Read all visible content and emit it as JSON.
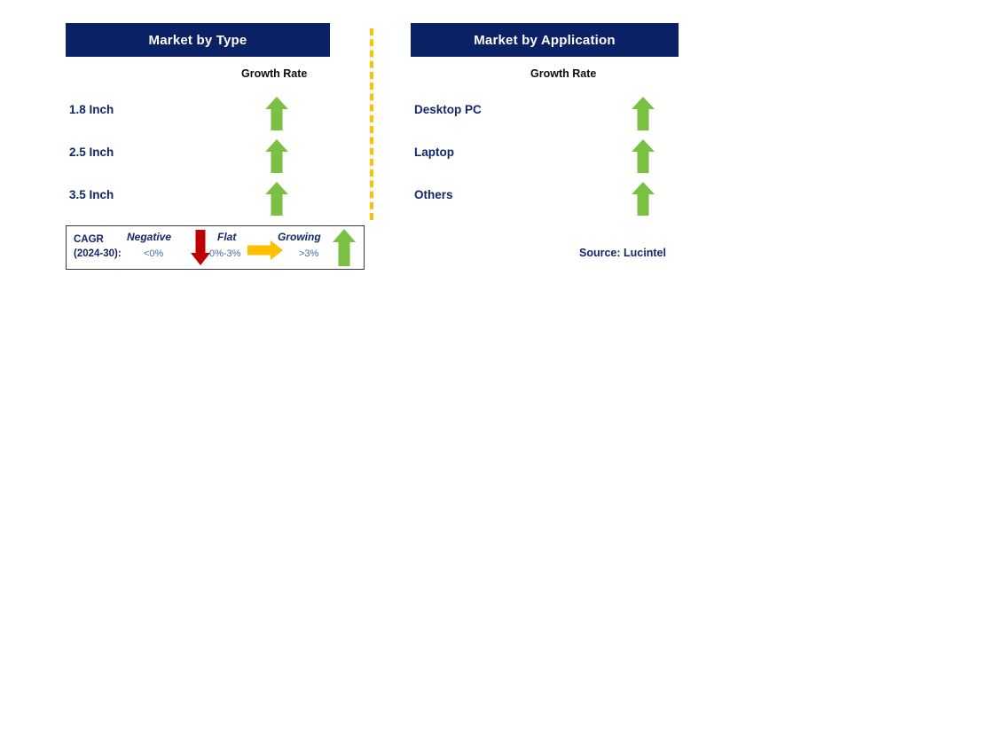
{
  "divider": {
    "color": "#FFC000",
    "style": "dashed-vertical"
  },
  "panels": [
    {
      "id": "type",
      "title": "Market by Type",
      "column_header": "Growth Rate",
      "rows": [
        {
          "label": "1.8 Inch",
          "growth": "growing",
          "icon": "up-arrow-icon"
        },
        {
          "label": "2.5 Inch",
          "growth": "growing",
          "icon": "up-arrow-icon"
        },
        {
          "label": "3.5 Inch",
          "growth": "growing",
          "icon": "up-arrow-icon"
        }
      ]
    },
    {
      "id": "application",
      "title": "Market by Application",
      "column_header": "Growth Rate",
      "rows": [
        {
          "label": "Desktop PC",
          "growth": "growing",
          "icon": "up-arrow-icon"
        },
        {
          "label": "Laptop",
          "growth": "growing",
          "icon": "up-arrow-icon"
        },
        {
          "label": "Others",
          "growth": "growing",
          "icon": "up-arrow-icon"
        }
      ]
    }
  ],
  "legend": {
    "cagr_line1": "CAGR",
    "cagr_line2": "(2024-30):",
    "items": [
      {
        "title": "Negative",
        "value": "<0%",
        "icon": "down-arrow-icon",
        "color": "#C00000"
      },
      {
        "title": "Flat",
        "value": "0%-3%",
        "icon": "right-arrow-icon",
        "color": "#FFC000"
      },
      {
        "title": "Growing",
        "value": ">3%",
        "icon": "up-arrow-icon",
        "color": "#7AC143"
      }
    ]
  },
  "source": "Source: Lucintel",
  "colors": {
    "header_bg": "#0a2265",
    "label_text": "#12266b",
    "growing": "#7AC143",
    "flat": "#FFC000",
    "negative": "#C00000",
    "legend_value_text": "#3f6fb5"
  }
}
